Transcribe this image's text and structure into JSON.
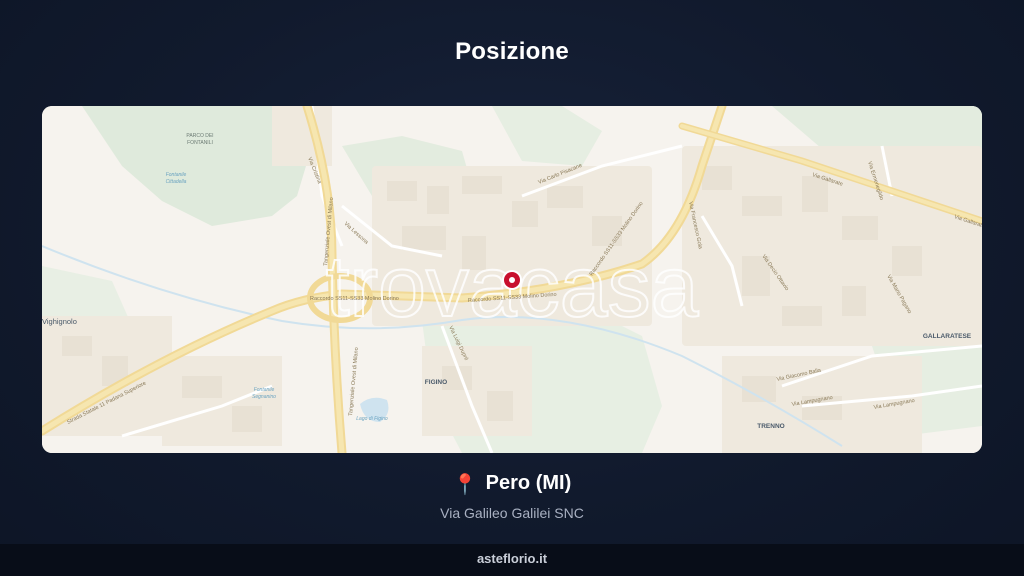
{
  "page": {
    "title": "Posizione"
  },
  "map": {
    "watermark": "trovacasa",
    "places": {
      "parco": [
        "PARCO DEI",
        "FONTANILI"
      ],
      "fontanile_cit": [
        "Fontanile",
        "Cittadella"
      ],
      "fontanile_seg": [
        "Fontanile",
        "Segnanino"
      ],
      "vighignolo": "Vighignolo",
      "figino": "FIGINO",
      "gallaratese": "GALLARATESE",
      "trenno": "TRENNO",
      "lago": "Lago di Figino"
    },
    "streets": {
      "raccordo_left": "Raccordo SS11-SS33 Molino Dorino",
      "raccordo_mid": "Raccordo SS11-SS33 Molino Dorino",
      "raccordo_right": "Raccordo SS11-SS33 Molino Dorino",
      "tangenziale_n": "Tangenziale Ovest di Milano",
      "tangenziale_s": "Tangenziale Ovest di Milano",
      "strada_statale": "Strada Statale 11 Padana Superiore",
      "via_gallarate": "Via Gallarate",
      "via_gallarate_2": "Via Gallarate",
      "via_carlo_pisacane": "Via Carlo Pisacane",
      "via_lessona": "Via Lessona",
      "via_cristina": "Via Cristina",
      "via_luigi_dupre": "Via Luigi Dupré",
      "via_giacomo_balla": "Via Giacomo Balla",
      "via_lampugnano": "Via Lampugnano",
      "via_lampugnano_2": "Via Lampugnano",
      "via_ermenegildo": "Via Ermenegildo",
      "via_francesco": "Via Francesco Gola",
      "via_mario": "Via Mario Pagano",
      "via_decio": "Via Decio Ottavio"
    },
    "marker": {
      "color": "#c8102e"
    }
  },
  "location": {
    "pin_icon": "📍",
    "city": "Pero (MI)",
    "address": "Via Galileo Galilei SNC"
  },
  "footer": {
    "site": "asteflorio.it"
  }
}
